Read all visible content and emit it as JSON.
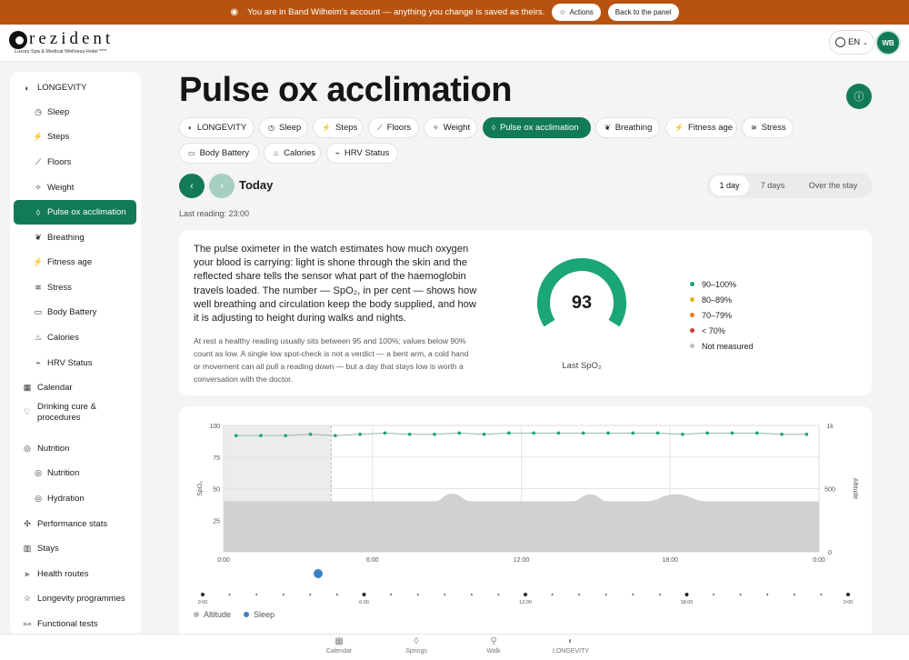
{
  "banner": {
    "message": "You are in Band Wilheim's account — anything you change is saved as theirs.",
    "actions_label": "Actions",
    "back_label": "Back to the panel"
  },
  "header": {
    "logo_word": "rezident",
    "logo_tagline": "Luxury Spa & Medical Wellness Hotel ****",
    "language": "EN",
    "avatar_initials": "WB"
  },
  "sidebar": {
    "items": [
      {
        "label": "LONGEVITY",
        "icon": "longevity-icon",
        "level": "top"
      },
      {
        "label": "Sleep",
        "icon": "clock-icon",
        "level": "sub"
      },
      {
        "label": "Steps",
        "icon": "steps-icon",
        "level": "sub"
      },
      {
        "label": "Floors",
        "icon": "floors-icon",
        "level": "sub"
      },
      {
        "label": "Weight",
        "icon": "weight-icon",
        "level": "sub"
      },
      {
        "label": "Pulse ox acclimation",
        "icon": "drop-icon",
        "level": "sub",
        "active": true
      },
      {
        "label": "Breathing",
        "icon": "lungs-icon",
        "level": "sub"
      },
      {
        "label": "Fitness age",
        "icon": "runner-icon",
        "level": "sub"
      },
      {
        "label": "Stress",
        "icon": "stress-icon",
        "level": "sub"
      },
      {
        "label": "Body Battery",
        "icon": "battery-icon",
        "level": "sub"
      },
      {
        "label": "Calories",
        "icon": "flame-icon",
        "level": "sub"
      },
      {
        "label": "HRV Status",
        "icon": "pulse-icon",
        "level": "sub"
      },
      {
        "label": "Calendar",
        "icon": "calendar-icon",
        "level": "top"
      },
      {
        "label": "Drinking cure & procedures",
        "icon": "drink-icon",
        "level": "top"
      },
      {
        "label": "Nutrition",
        "icon": "nutrition-icon",
        "level": "top"
      },
      {
        "label": "Nutrition",
        "icon": "nutrition-icon",
        "level": "sub"
      },
      {
        "label": "Hydration",
        "icon": "hydration-icon",
        "level": "sub"
      },
      {
        "label": "Performance stats",
        "icon": "stats-icon",
        "level": "top"
      },
      {
        "label": "Stays",
        "icon": "building-icon",
        "level": "top"
      },
      {
        "label": "Health routes",
        "icon": "route-icon",
        "level": "top"
      },
      {
        "label": "Longevity programmes",
        "icon": "star-icon",
        "level": "top"
      },
      {
        "label": "Functional tests",
        "icon": "dumbbell-icon",
        "level": "top"
      }
    ]
  },
  "page": {
    "title": "Pulse ox acclimation",
    "today_label": "Today",
    "last_reading": "Last reading: 23:00"
  },
  "chips": [
    {
      "label": "LONGEVITY",
      "icon": "longevity-icon"
    },
    {
      "label": "Sleep",
      "icon": "clock-icon"
    },
    {
      "label": "Steps",
      "icon": "steps-icon"
    },
    {
      "label": "Floors",
      "icon": "floors-icon"
    },
    {
      "label": "Weight",
      "icon": "weight-icon"
    },
    {
      "label": "Pulse ox acclimation",
      "icon": "drop-icon",
      "active": true
    },
    {
      "label": "Breathing",
      "icon": "lungs-icon"
    },
    {
      "label": "Fitness age",
      "icon": "runner-icon"
    },
    {
      "label": "Stress",
      "icon": "stress-icon"
    },
    {
      "label": "Body Battery",
      "icon": "battery-icon"
    },
    {
      "label": "Calories",
      "icon": "flame-icon"
    },
    {
      "label": "HRV Status",
      "icon": "pulse-icon"
    }
  ],
  "range": {
    "options": [
      "1 day",
      "7 days",
      "Over the stay"
    ],
    "selected": "1 day"
  },
  "summary": {
    "description": "The pulse oximeter in the watch estimates how much oxygen your blood is carrying: light is shone through the skin and the reflected share tells the sensor what part of the haemoglobin travels loaded. The number — SpO₂, in per cent — shows how well breathing and circulation keep the body supplied, and how it is adjusting to height during walks and nights.",
    "note": "At rest a healthy reading usually sits between 95 and 100%; values below 90% count as low. A single low spot-check is not a verdict — a bent arm, a cold hand or movement can all pull a reading down — but a day that stays low is worth a conversation with the doctor.",
    "value": "93",
    "value_label": "Last SpO₂",
    "gauge_fraction": 0.93,
    "legend": [
      {
        "label": "90–100%",
        "color": "#1aa676"
      },
      {
        "label": "80–89%",
        "color": "#e0b21a"
      },
      {
        "label": "70–79%",
        "color": "#ea7d1a"
      },
      {
        "label": "< 70%",
        "color": "#d5382a"
      },
      {
        "label": "Not measured",
        "color": "#bdbdbd"
      }
    ]
  },
  "chart_data": {
    "type": "line",
    "ylabel": "SpO₂",
    "y2label": "Altitude",
    "y_ticks": [
      "100",
      "75",
      "50",
      "25"
    ],
    "y2_ticks": [
      "1k",
      "500",
      "0"
    ],
    "x_ticks": [
      "0:00",
      "6:00",
      "12:00",
      "18:00",
      "0:00"
    ],
    "ylim": [
      0,
      100
    ],
    "y2lim": [
      0,
      1000
    ],
    "sleep_window": [
      "0:00",
      "4:20"
    ],
    "series": [
      {
        "name": "SpO₂",
        "color": "#1aa676",
        "x": [
          0.5,
          1.5,
          2.5,
          3.5,
          4.5,
          5.5,
          6.5,
          7.5,
          8.5,
          9.5,
          10.5,
          11.5,
          12.5,
          13.5,
          14.5,
          15.5,
          16.5,
          17.5,
          18.5,
          19.5,
          20.5,
          21.5,
          22.5,
          23.5
        ],
        "values": [
          92,
          92,
          92,
          93,
          92,
          93,
          94,
          93,
          93,
          94,
          93,
          94,
          94,
          94,
          94,
          94,
          94,
          94,
          93,
          94,
          94,
          94,
          93,
          93
        ]
      },
      {
        "name": "Altitude",
        "color": "#cfcfcd",
        "x": [
          0,
          6.5,
          8.5,
          9.2,
          10.0,
          11.0,
          14,
          14.8,
          15.5,
          16.2,
          17,
          18.2,
          19.5,
          20.5,
          24
        ],
        "values": [
          400,
          400,
          400,
          460,
          400,
          400,
          400,
          455,
          400,
          400,
          400,
          455,
          400,
          400,
          400
        ]
      }
    ],
    "timeline": {
      "ticks": [
        "0:00",
        "6:00",
        "12:00",
        "18:00",
        "0:00"
      ],
      "marker_icon": "runner-icon"
    },
    "legend": [
      {
        "label": "Altitude",
        "color": "#b7b7b5"
      },
      {
        "label": "Sleep",
        "color": "#3b82c4"
      }
    ]
  },
  "bottom_nav": [
    {
      "label": "Calendar",
      "icon": "calendar-icon"
    },
    {
      "label": "Springs",
      "icon": "drop-icon"
    },
    {
      "label": "Walk",
      "icon": "walk-icon"
    },
    {
      "label": "LONGEVITY",
      "icon": "longevity-icon"
    }
  ]
}
